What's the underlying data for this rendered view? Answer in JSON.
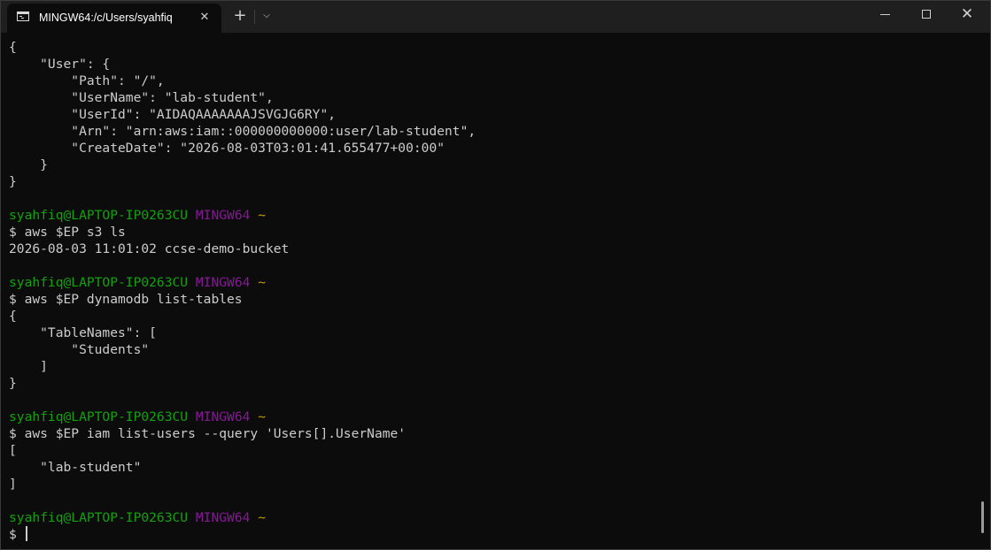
{
  "window": {
    "tab_title": "MINGW64:/c/Users/syahfiq",
    "tab_close_glyph": "✕",
    "new_tab_glyph": "+",
    "dropdown_glyph": "⌵",
    "close_glyph": "✕"
  },
  "colors": {
    "background": "#0c0c0c",
    "foreground": "#cccccc",
    "prompt_user": "#13a10e",
    "prompt_system": "#881798",
    "prompt_path": "#c19c00"
  },
  "terminal": {
    "lines": [
      {
        "type": "out",
        "text": "{"
      },
      {
        "type": "out",
        "text": "    \"User\": {"
      },
      {
        "type": "out",
        "text": "        \"Path\": \"/\","
      },
      {
        "type": "out",
        "text": "        \"UserName\": \"lab-student\","
      },
      {
        "type": "out",
        "text": "        \"UserId\": \"AIDAQAAAAAAAJSVGJG6RY\","
      },
      {
        "type": "out",
        "text": "        \"Arn\": \"arn:aws:iam::000000000000:user/lab-student\","
      },
      {
        "type": "out",
        "text": "        \"CreateDate\": \"2026-08-03T03:01:41.655477+00:00\""
      },
      {
        "type": "out",
        "text": "    }"
      },
      {
        "type": "out",
        "text": "}"
      },
      {
        "type": "out",
        "text": ""
      },
      {
        "type": "prompt",
        "user": "syahfiq@LAPTOP-IP0263CU",
        "system": "MINGW64",
        "path": "~"
      },
      {
        "type": "out",
        "text": "$ aws $EP s3 ls"
      },
      {
        "type": "out",
        "text": "2026-08-03 11:01:02 ccse-demo-bucket"
      },
      {
        "type": "out",
        "text": ""
      },
      {
        "type": "prompt",
        "user": "syahfiq@LAPTOP-IP0263CU",
        "system": "MINGW64",
        "path": "~"
      },
      {
        "type": "out",
        "text": "$ aws $EP dynamodb list-tables"
      },
      {
        "type": "out",
        "text": "{"
      },
      {
        "type": "out",
        "text": "    \"TableNames\": ["
      },
      {
        "type": "out",
        "text": "        \"Students\""
      },
      {
        "type": "out",
        "text": "    ]"
      },
      {
        "type": "out",
        "text": "}"
      },
      {
        "type": "out",
        "text": ""
      },
      {
        "type": "prompt",
        "user": "syahfiq@LAPTOP-IP0263CU",
        "system": "MINGW64",
        "path": "~"
      },
      {
        "type": "out",
        "text": "$ aws $EP iam list-users --query 'Users[].UserName'"
      },
      {
        "type": "out",
        "text": "["
      },
      {
        "type": "out",
        "text": "    \"lab-student\""
      },
      {
        "type": "out",
        "text": "]"
      },
      {
        "type": "out",
        "text": ""
      },
      {
        "type": "prompt",
        "user": "syahfiq@LAPTOP-IP0263CU",
        "system": "MINGW64",
        "path": "~"
      },
      {
        "type": "input",
        "text": "$ "
      }
    ]
  }
}
